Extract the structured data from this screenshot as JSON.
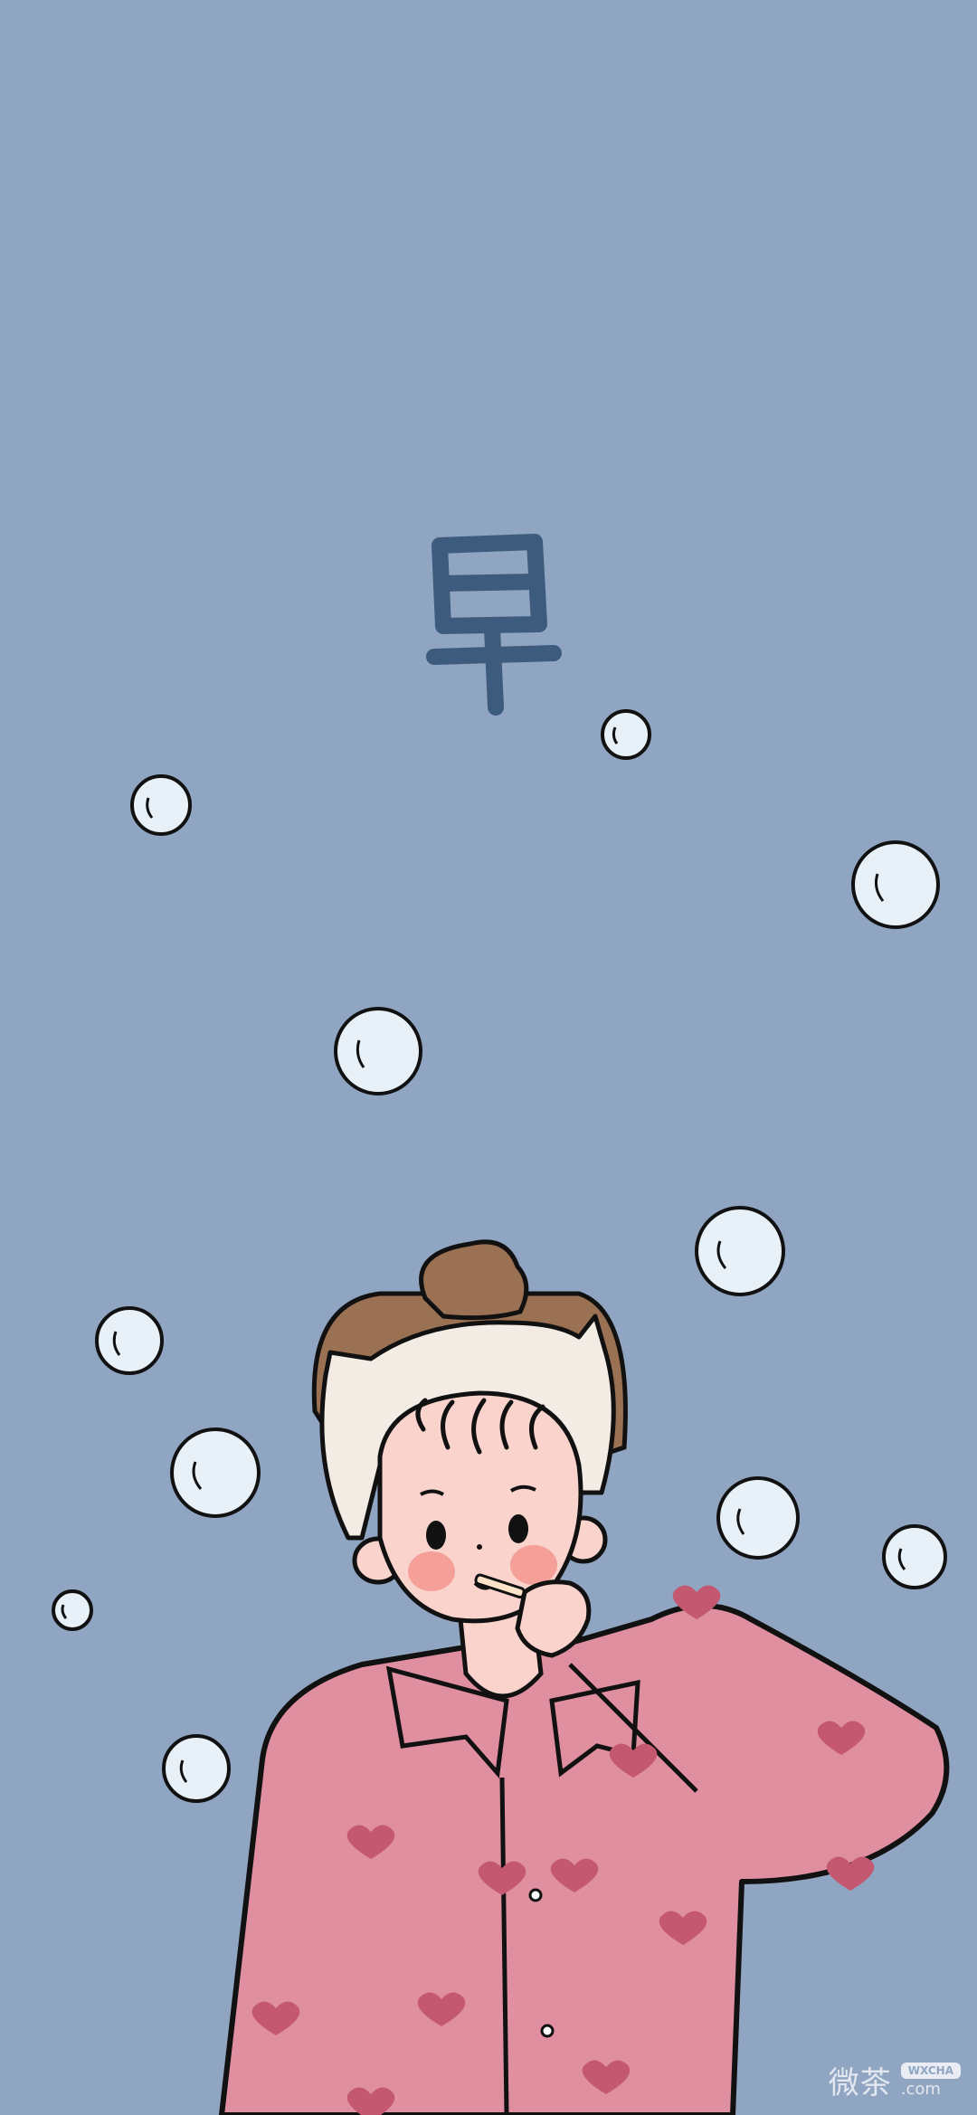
{
  "greeting": {
    "char": "早"
  },
  "watermark": {
    "brand_cn": "微茶",
    "brand_tag": "WXCHA",
    "domain_suffix": ".com"
  },
  "colors": {
    "background": "#8fa5c1",
    "greeting_text": "#3d5b7c",
    "bubble_fill": "#e8f1f8",
    "pajama": "#df8fa0",
    "heart": "#c45870",
    "hair": "#9a7152",
    "headband": "#f3ece4",
    "skin": "#fbd3cd",
    "cheek": "#f39a92",
    "outline": "#111111"
  },
  "scene": {
    "subject": "girl-brushing-teeth",
    "decorations": "bubbles"
  }
}
